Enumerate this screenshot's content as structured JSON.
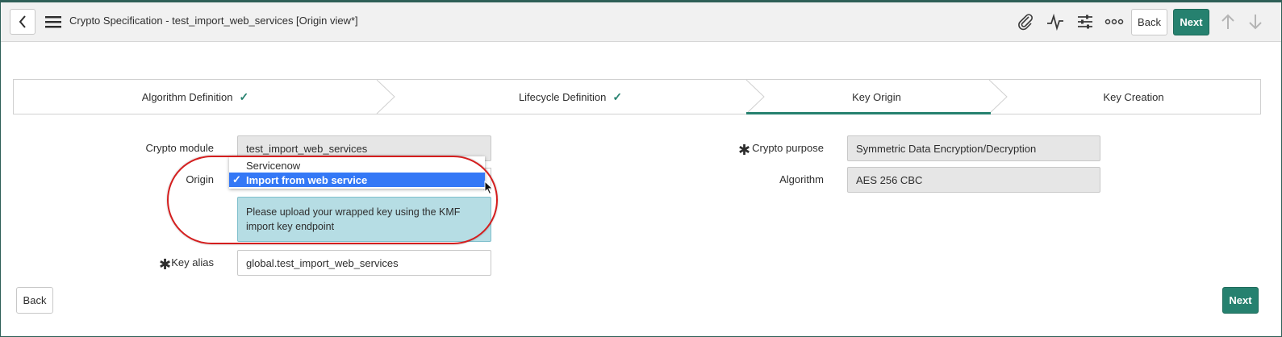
{
  "header": {
    "title": "Crypto Specification - test_import_web_services [Origin view*]",
    "back_label": "Back",
    "next_label": "Next",
    "icons": [
      "chevron-left-icon",
      "hamburger-icon",
      "paperclip-icon",
      "activity-icon",
      "sliders-icon",
      "more-icon",
      "arrow-up-icon",
      "arrow-down-icon"
    ]
  },
  "steps": [
    {
      "label": "Algorithm Definition",
      "status": "complete"
    },
    {
      "label": "Lifecycle Definition",
      "status": "complete"
    },
    {
      "label": "Key Origin",
      "status": "active"
    },
    {
      "label": "Key Creation",
      "status": "pending"
    }
  ],
  "form": {
    "crypto_module": {
      "label": "Crypto module",
      "value": "test_import_web_services"
    },
    "origin": {
      "label": "Origin",
      "options": [
        "Servicenow",
        "Import from web service"
      ],
      "selected": "Import from web service",
      "check": "✓"
    },
    "info_message": "Please upload your wrapped key using the KMF import key endpoint",
    "key_alias": {
      "label": "Key alias",
      "value": "global.test_import_web_services",
      "required": true
    },
    "crypto_purpose": {
      "label": "Crypto purpose",
      "value": "Symmetric Data Encryption/Decryption",
      "required": true
    },
    "algorithm": {
      "label": "Algorithm",
      "value": "AES 256 CBC"
    }
  },
  "footer": {
    "back_label": "Back",
    "next_label": "Next"
  },
  "colors": {
    "accent": "#26816f",
    "info_bg": "#b6dde4",
    "select_highlight": "#3478f6",
    "annotation": "#d41e1e"
  }
}
